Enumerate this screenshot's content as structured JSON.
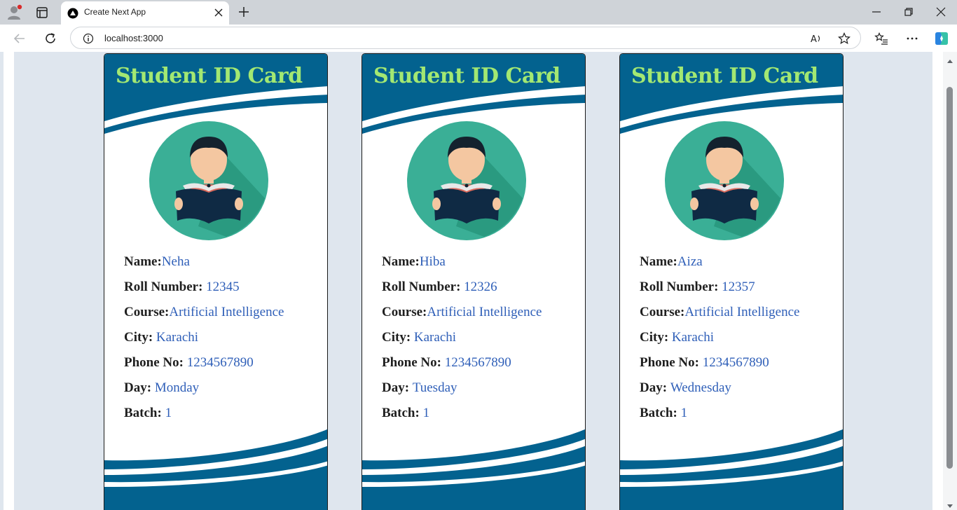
{
  "browser": {
    "tab_title": "Create Next App",
    "url": "localhost:3000"
  },
  "cards": [
    {
      "title": "Student ID Card",
      "fields": [
        {
          "label": "Name:",
          "value": "Neha"
        },
        {
          "label": "Roll Number: ",
          "value": "12345"
        },
        {
          "label": "Course:",
          "value": "Artificial Intelligence"
        },
        {
          "label": "City: ",
          "value": "Karachi"
        },
        {
          "label": "Phone No: ",
          "value": "1234567890"
        },
        {
          "label": "Day: ",
          "value": "Monday"
        },
        {
          "label": "Batch: ",
          "value": "1"
        }
      ]
    },
    {
      "title": "Student ID Card",
      "fields": [
        {
          "label": "Name:",
          "value": "Hiba"
        },
        {
          "label": "Roll Number: ",
          "value": "12326"
        },
        {
          "label": "Course:",
          "value": "Artificial Intelligence"
        },
        {
          "label": "City: ",
          "value": "Karachi"
        },
        {
          "label": "Phone No: ",
          "value": "1234567890"
        },
        {
          "label": "Day: ",
          "value": "Tuesday"
        },
        {
          "label": "Batch: ",
          "value": "1"
        }
      ]
    },
    {
      "title": "Student ID Card",
      "fields": [
        {
          "label": "Name:",
          "value": "Aiza"
        },
        {
          "label": "Roll Number: ",
          "value": "12357"
        },
        {
          "label": "Course:",
          "value": "Artificial Intelligence"
        },
        {
          "label": "City: ",
          "value": "Karachi"
        },
        {
          "label": "Phone No: ",
          "value": "1234567890"
        },
        {
          "label": "Day: ",
          "value": "Wednesday"
        },
        {
          "label": "Batch: ",
          "value": "1"
        }
      ]
    }
  ],
  "colors": {
    "card_header": "#03628f",
    "title": "#a3e872",
    "value_text": "#2f5fb8",
    "avatar_bg": "#3aaf96"
  }
}
